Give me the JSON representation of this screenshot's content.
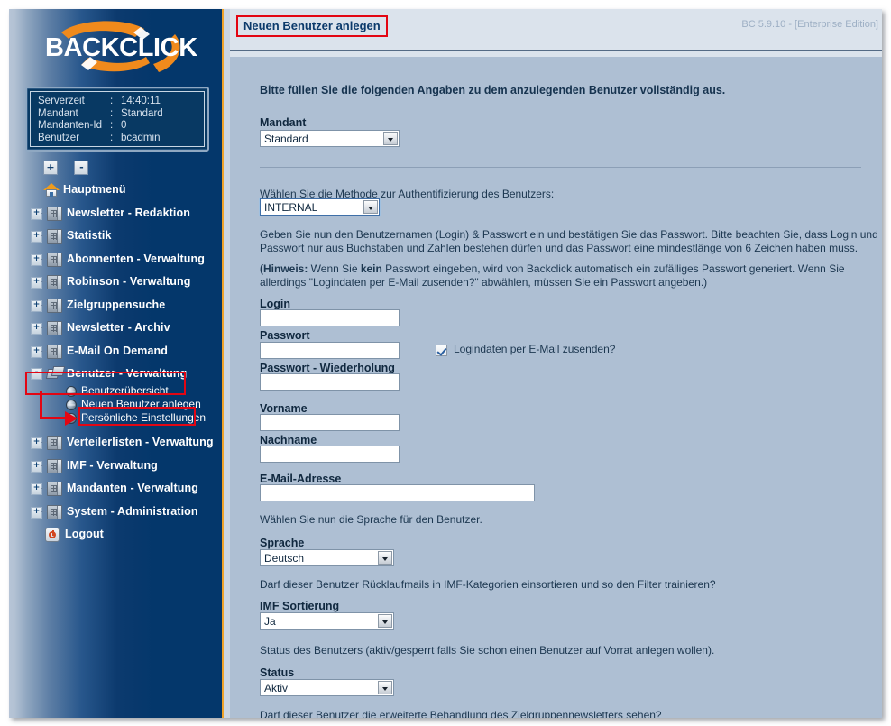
{
  "app": {
    "brand": "BACKCLICK",
    "version_label": "BC 5.9.10 - [Enterprise Edition]",
    "accent_orange": "#f0a32a",
    "sidebar_dark": "#04376b",
    "annotation_red": "#e30613",
    "content_bg": "#aebfd3",
    "header_bg": "#dbe3ec"
  },
  "sidebar": {
    "info": {
      "rows": [
        {
          "key": "Serverzeit",
          "sep": ":",
          "value": "14:40:11"
        },
        {
          "key": "Mandant",
          "sep": ":",
          "value": "Standard"
        },
        {
          "key": "Mandanten-Id",
          "sep": ":",
          "value": "0"
        },
        {
          "key": "Benutzer",
          "sep": ":",
          "value": "bcadmin"
        }
      ]
    },
    "expand_all_label": "+",
    "collapse_all_label": "-",
    "items": [
      {
        "label": "Hauptmenü",
        "icon": "house-icon",
        "toggle": "",
        "level": 0
      },
      {
        "label": "Newsletter - Redaktion",
        "icon": "building-icon",
        "toggle": "+",
        "level": 0
      },
      {
        "label": "Statistik",
        "icon": "building-icon",
        "toggle": "+",
        "level": 0
      },
      {
        "label": "Abonnenten - Verwaltung",
        "icon": "building-icon",
        "toggle": "+",
        "level": 0
      },
      {
        "label": "Robinson - Verwaltung",
        "icon": "building-icon",
        "toggle": "+",
        "level": 0
      },
      {
        "label": "Zielgruppensuche",
        "icon": "building-icon",
        "toggle": "+",
        "level": 0
      },
      {
        "label": "Newsletter - Archiv",
        "icon": "building-icon",
        "toggle": "+",
        "level": 0
      },
      {
        "label": "E-Mail On Demand",
        "icon": "building-icon",
        "toggle": "+",
        "level": 0
      },
      {
        "label": "Benutzer - Verwaltung",
        "icon": "user-cards-icon",
        "toggle": "-",
        "level": 0
      },
      {
        "label": "Verteilerlisten - Verwaltung",
        "icon": "building-icon",
        "toggle": "+",
        "level": 0
      },
      {
        "label": "IMF - Verwaltung",
        "icon": "building-icon",
        "toggle": "+",
        "level": 0
      },
      {
        "label": "Mandanten - Verwaltung",
        "icon": "building-icon",
        "toggle": "+",
        "level": 0
      },
      {
        "label": "System - Administration",
        "icon": "building-icon",
        "toggle": "+",
        "level": 0
      },
      {
        "label": "Logout",
        "icon": "power-icon",
        "toggle": "",
        "level": 0
      }
    ],
    "subitems": [
      {
        "label": "Benutzerübersicht",
        "icon": "sphere-icon"
      },
      {
        "label": "Neuen Benutzer anlegen",
        "icon": "sphere-icon"
      },
      {
        "label": "Persönliche Einstellungen",
        "icon": "sphere-icon"
      }
    ]
  },
  "main": {
    "title": "Neuen Benutzer anlegen",
    "intro": "Bitte füllen Sie die folgenden Angaben zu dem anzulegenden Benutzer vollständig aus.",
    "mandant": {
      "label": "Mandant",
      "value": "Standard"
    },
    "auth": {
      "question": "Wählen Sie die Methode zur Authentifizierung des Benutzers:",
      "value": "INTERNAL"
    },
    "password_note_1": "Geben Sie nun den Benutzernamen (Login) & Passwort ein und bestätigen Sie das Passwort. Bitte beachten Sie, dass Login und Passwort nur aus Buchstaben und Zahlen bestehen dürfen und das Passwort eine mindestlänge von 6 Zeichen haben muss.",
    "password_note_2_prefix": "(Hinweis:",
    "password_note_2_a": " Wenn Sie ",
    "password_note_2_bold": "kein",
    "password_note_2_b": " Passwort eingeben, wird von Backclick automatisch ein zufälliges Passwort generiert. Wenn Sie allerdings \"Logindaten per E-Mail zusenden?\" abwählen, müssen Sie ein Passwort angeben.)",
    "fields": {
      "login_label": "Login",
      "login_value": "",
      "password_label": "Passwort",
      "password_value": "",
      "password_repeat_label": "Passwort - Wiederholung",
      "password_repeat_value": "",
      "firstname_label": "Vorname",
      "firstname_value": "",
      "lastname_label": "Nachname",
      "lastname_value": "",
      "email_label": "E-Mail-Adresse",
      "email_value": ""
    },
    "send_login_checkbox": {
      "label": "Logindaten per E-Mail zusenden?",
      "checked": true
    },
    "language": {
      "question": "Wählen Sie nun die Sprache für den Benutzer.",
      "label": "Sprache",
      "value": "Deutsch"
    },
    "imf": {
      "question": "Darf dieser Benutzer Rücklaufmails in IMF-Kategorien einsortieren und so den Filter trainieren?",
      "label": "IMF Sortierung",
      "value": "Ja"
    },
    "status": {
      "question": "Status des Benutzers (aktiv/gesperrt falls Sie schon einen Benutzer auf Vorrat anlegen wollen).",
      "label": "Status",
      "value": "Aktiv"
    },
    "target_group_question": "Darf dieser Benutzer die erweiterte Behandlung des Zielgruppennewsletters sehen?"
  }
}
